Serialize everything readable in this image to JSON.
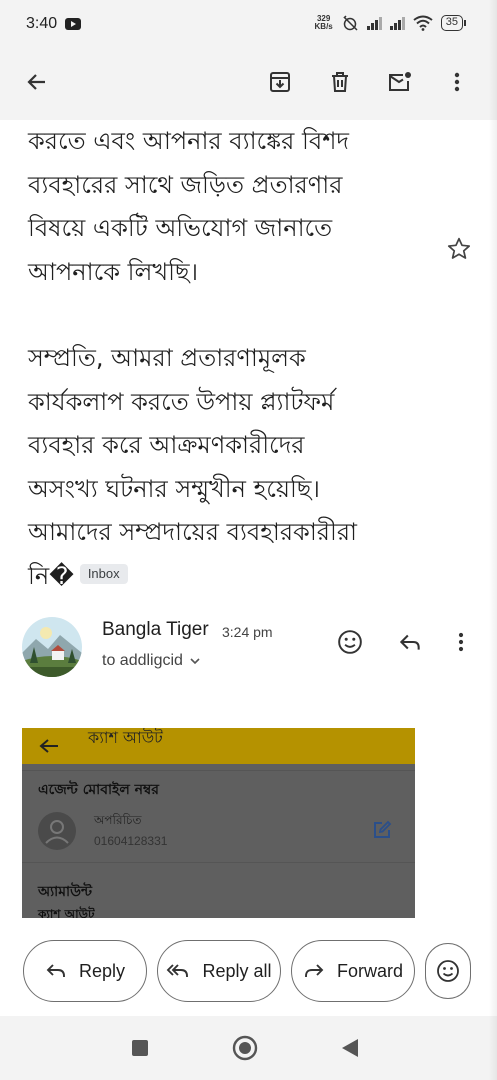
{
  "status_bar": {
    "time": "3:40",
    "net_speed_value": "329",
    "net_speed_unit": "KB/s",
    "battery": "35"
  },
  "app_bar": {
    "icons": [
      "back-arrow-icon",
      "archive-icon",
      "delete-icon",
      "mark-unread-icon",
      "more-vert-icon"
    ]
  },
  "message": {
    "paragraph_1": [
      "করতে এবং আপনার ব্যাঙ্কের বিশদ",
      "ব্যবহারের সাথে জড়িত প্রতারণার",
      "বিষয়ে একটি অভিযোগ জানাতে",
      "আপনাকে লিখছি।"
    ],
    "paragraph_2": [
      "সম্প্রতি, আমরা প্রতারণামূলক",
      "কার্যকলাপ করতে উপায় প্ল্যাটফর্ম",
      "ব্যবহার করে আক্রমণকারীদের",
      "অসংখ্য ঘটনার সম্মুখীন হয়েছি।",
      "আমাদের সম্প্রদায়ের ব্যবহারকারীরা",
      "নি�"
    ],
    "label_chip": "Inbox"
  },
  "sender": {
    "name": "Bangla Tiger",
    "time": "3:24 pm",
    "to": "to addligcid"
  },
  "embedded_image": {
    "title": "ক্যাশ আউট",
    "agent_label": "এজেন্ট মোবাইল নম্বর",
    "agent_status": "অপরিচিত",
    "agent_number": "01604128331",
    "amount_label": "অ্যামাউন্ট",
    "cut_text": "ক্যাশ আউট"
  },
  "actions": {
    "reply": "Reply",
    "reply_all": "Reply all",
    "forward": "Forward"
  }
}
